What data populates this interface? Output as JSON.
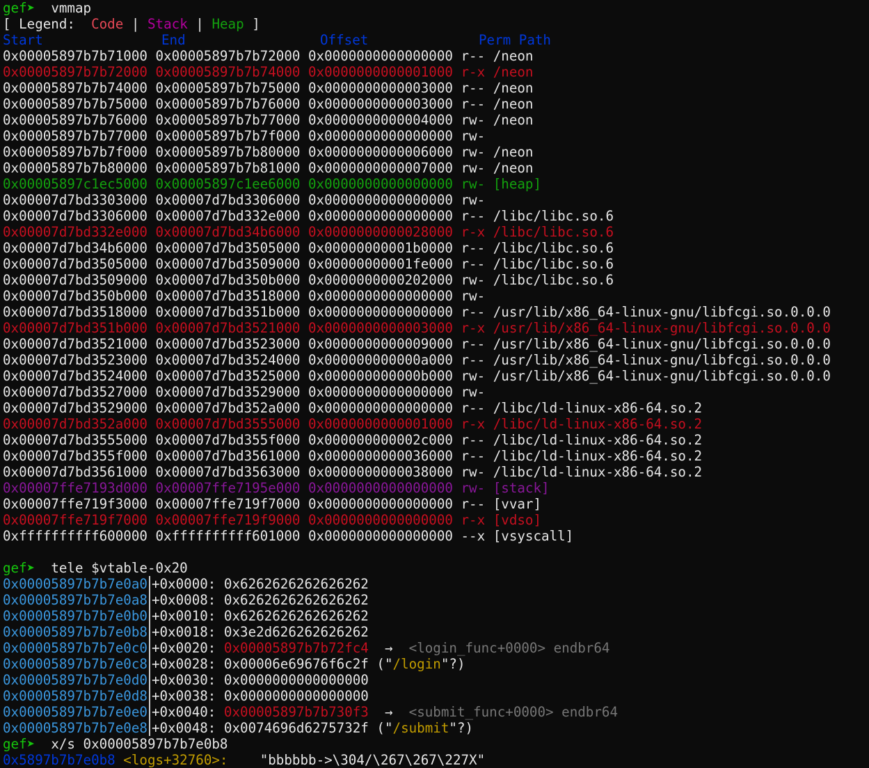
{
  "colors": {
    "background": "#0c0c0c",
    "text": "#e6e6e6",
    "prompt": "#16c60c",
    "code": "#c50f1f",
    "stack": "#881798",
    "heap": "#13a10e",
    "header": "#0037da",
    "address": "#3a96dd",
    "string": "#c19c00"
  },
  "prompt": "gef➤",
  "cmd_vmmap": "vmmap",
  "legend": {
    "prefix": "[ Legend:",
    "code": "Code",
    "sep": "|",
    "stack": "Stack",
    "heap": "Heap",
    "suffix": "]"
  },
  "vmmap_header": {
    "start": "Start",
    "end": "End",
    "offset": "Offset",
    "perm": "Perm",
    "path": "Path"
  },
  "vmmap_rows": [
    {
      "start": "0x00005897b7b71000",
      "end": "0x00005897b7b72000",
      "offset": "0x0000000000000000",
      "perm": "r--",
      "path": "/neon",
      "kind": "normal"
    },
    {
      "start": "0x00005897b7b72000",
      "end": "0x00005897b7b74000",
      "offset": "0x0000000000001000",
      "perm": "r-x",
      "path": "/neon",
      "kind": "code"
    },
    {
      "start": "0x00005897b7b74000",
      "end": "0x00005897b7b75000",
      "offset": "0x0000000000003000",
      "perm": "r--",
      "path": "/neon",
      "kind": "normal"
    },
    {
      "start": "0x00005897b7b75000",
      "end": "0x00005897b7b76000",
      "offset": "0x0000000000003000",
      "perm": "r--",
      "path": "/neon",
      "kind": "normal"
    },
    {
      "start": "0x00005897b7b76000",
      "end": "0x00005897b7b77000",
      "offset": "0x0000000000004000",
      "perm": "rw-",
      "path": "/neon",
      "kind": "normal"
    },
    {
      "start": "0x00005897b7b77000",
      "end": "0x00005897b7b7f000",
      "offset": "0x0000000000000000",
      "perm": "rw-",
      "path": "",
      "kind": "normal"
    },
    {
      "start": "0x00005897b7b7f000",
      "end": "0x00005897b7b80000",
      "offset": "0x0000000000006000",
      "perm": "rw-",
      "path": "/neon",
      "kind": "normal"
    },
    {
      "start": "0x00005897b7b80000",
      "end": "0x00005897b7b81000",
      "offset": "0x0000000000007000",
      "perm": "rw-",
      "path": "/neon",
      "kind": "normal"
    },
    {
      "start": "0x00005897c1ec5000",
      "end": "0x00005897c1ee6000",
      "offset": "0x0000000000000000",
      "perm": "rw-",
      "path": "[heap]",
      "kind": "heap"
    },
    {
      "start": "0x00007d7bd3303000",
      "end": "0x00007d7bd3306000",
      "offset": "0x0000000000000000",
      "perm": "rw-",
      "path": "",
      "kind": "normal"
    },
    {
      "start": "0x00007d7bd3306000",
      "end": "0x00007d7bd332e000",
      "offset": "0x0000000000000000",
      "perm": "r--",
      "path": "/libc/libc.so.6",
      "kind": "normal"
    },
    {
      "start": "0x00007d7bd332e000",
      "end": "0x00007d7bd34b6000",
      "offset": "0x0000000000028000",
      "perm": "r-x",
      "path": "/libc/libc.so.6",
      "kind": "code"
    },
    {
      "start": "0x00007d7bd34b6000",
      "end": "0x00007d7bd3505000",
      "offset": "0x00000000001b0000",
      "perm": "r--",
      "path": "/libc/libc.so.6",
      "kind": "normal"
    },
    {
      "start": "0x00007d7bd3505000",
      "end": "0x00007d7bd3509000",
      "offset": "0x00000000001fe000",
      "perm": "r--",
      "path": "/libc/libc.so.6",
      "kind": "normal"
    },
    {
      "start": "0x00007d7bd3509000",
      "end": "0x00007d7bd350b000",
      "offset": "0x0000000000202000",
      "perm": "rw-",
      "path": "/libc/libc.so.6",
      "kind": "normal"
    },
    {
      "start": "0x00007d7bd350b000",
      "end": "0x00007d7bd3518000",
      "offset": "0x0000000000000000",
      "perm": "rw-",
      "path": "",
      "kind": "normal"
    },
    {
      "start": "0x00007d7bd3518000",
      "end": "0x00007d7bd351b000",
      "offset": "0x0000000000000000",
      "perm": "r--",
      "path": "/usr/lib/x86_64-linux-gnu/libfcgi.so.0.0.0",
      "kind": "normal"
    },
    {
      "start": "0x00007d7bd351b000",
      "end": "0x00007d7bd3521000",
      "offset": "0x0000000000003000",
      "perm": "r-x",
      "path": "/usr/lib/x86_64-linux-gnu/libfcgi.so.0.0.0",
      "kind": "code"
    },
    {
      "start": "0x00007d7bd3521000",
      "end": "0x00007d7bd3523000",
      "offset": "0x0000000000009000",
      "perm": "r--",
      "path": "/usr/lib/x86_64-linux-gnu/libfcgi.so.0.0.0",
      "kind": "normal"
    },
    {
      "start": "0x00007d7bd3523000",
      "end": "0x00007d7bd3524000",
      "offset": "0x000000000000a000",
      "perm": "r--",
      "path": "/usr/lib/x86_64-linux-gnu/libfcgi.so.0.0.0",
      "kind": "normal"
    },
    {
      "start": "0x00007d7bd3524000",
      "end": "0x00007d7bd3525000",
      "offset": "0x000000000000b000",
      "perm": "rw-",
      "path": "/usr/lib/x86_64-linux-gnu/libfcgi.so.0.0.0",
      "kind": "normal"
    },
    {
      "start": "0x00007d7bd3527000",
      "end": "0x00007d7bd3529000",
      "offset": "0x0000000000000000",
      "perm": "rw-",
      "path": "",
      "kind": "normal"
    },
    {
      "start": "0x00007d7bd3529000",
      "end": "0x00007d7bd352a000",
      "offset": "0x0000000000000000",
      "perm": "r--",
      "path": "/libc/ld-linux-x86-64.so.2",
      "kind": "normal"
    },
    {
      "start": "0x00007d7bd352a000",
      "end": "0x00007d7bd3555000",
      "offset": "0x0000000000001000",
      "perm": "r-x",
      "path": "/libc/ld-linux-x86-64.so.2",
      "kind": "code"
    },
    {
      "start": "0x00007d7bd3555000",
      "end": "0x00007d7bd355f000",
      "offset": "0x000000000002c000",
      "perm": "r--",
      "path": "/libc/ld-linux-x86-64.so.2",
      "kind": "normal"
    },
    {
      "start": "0x00007d7bd355f000",
      "end": "0x00007d7bd3561000",
      "offset": "0x0000000000036000",
      "perm": "r--",
      "path": "/libc/ld-linux-x86-64.so.2",
      "kind": "normal"
    },
    {
      "start": "0x00007d7bd3561000",
      "end": "0x00007d7bd3563000",
      "offset": "0x0000000000038000",
      "perm": "rw-",
      "path": "/libc/ld-linux-x86-64.so.2",
      "kind": "normal"
    },
    {
      "start": "0x00007ffe7193d000",
      "end": "0x00007ffe7195e000",
      "offset": "0x0000000000000000",
      "perm": "rw-",
      "path": "[stack]",
      "kind": "stack"
    },
    {
      "start": "0x00007ffe719f3000",
      "end": "0x00007ffe719f7000",
      "offset": "0x0000000000000000",
      "perm": "r--",
      "path": "[vvar]",
      "kind": "normal"
    },
    {
      "start": "0x00007ffe719f7000",
      "end": "0x00007ffe719f9000",
      "offset": "0x0000000000000000",
      "perm": "r-x",
      "path": "[vdso]",
      "kind": "code"
    },
    {
      "start": "0xffffffffff600000",
      "end": "0xffffffffff601000",
      "offset": "0x0000000000000000",
      "perm": "--x",
      "path": "[vsyscall]",
      "kind": "normal"
    }
  ],
  "cmd_tele": "tele $vtable-0x20",
  "tele_rows": [
    {
      "addr": "0x00005897b7b7e0a0",
      "off": "+0x0000:",
      "value": "0x6262626262626262",
      "value_kind": "plain",
      "arrow": "",
      "sym": "",
      "insn": "",
      "str": ""
    },
    {
      "addr": "0x00005897b7b7e0a8",
      "off": "+0x0008:",
      "value": "0x6262626262626262",
      "value_kind": "plain",
      "arrow": "",
      "sym": "",
      "insn": "",
      "str": ""
    },
    {
      "addr": "0x00005897b7b7e0b0",
      "off": "+0x0010:",
      "value": "0x6262626262626262",
      "value_kind": "plain",
      "arrow": "",
      "sym": "",
      "insn": "",
      "str": ""
    },
    {
      "addr": "0x00005897b7b7e0b8",
      "off": "+0x0018:",
      "value": "0x3e2d626262626262",
      "value_kind": "plain",
      "arrow": "",
      "sym": "",
      "insn": "",
      "str": ""
    },
    {
      "addr": "0x00005897b7b7e0c0",
      "off": "+0x0020:",
      "value": "0x00005897b7b72fc4",
      "value_kind": "code",
      "arrow": "→",
      "sym": "<login_func+0000>",
      "insn": "endbr64",
      "str": ""
    },
    {
      "addr": "0x00005897b7b7e0c8",
      "off": "+0x0028:",
      "value": "0x00006e69676f6c2f",
      "value_kind": "plain",
      "arrow": "",
      "sym": "",
      "insn": "",
      "str": "/login"
    },
    {
      "addr": "0x00005897b7b7e0d0",
      "off": "+0x0030:",
      "value": "0x0000000000000000",
      "value_kind": "plain",
      "arrow": "",
      "sym": "",
      "insn": "",
      "str": ""
    },
    {
      "addr": "0x00005897b7b7e0d8",
      "off": "+0x0038:",
      "value": "0x0000000000000000",
      "value_kind": "plain",
      "arrow": "",
      "sym": "",
      "insn": "",
      "str": ""
    },
    {
      "addr": "0x00005897b7b7e0e0",
      "off": "+0x0040:",
      "value": "0x00005897b7b730f3",
      "value_kind": "code",
      "arrow": "→",
      "sym": "<submit_func+0000>",
      "insn": "endbr64",
      "str": ""
    },
    {
      "addr": "0x00005897b7b7e0e8",
      "off": "+0x0048:",
      "value": "0x0074696d6275732f",
      "value_kind": "plain",
      "arrow": "",
      "sym": "",
      "insn": "",
      "str": "/submit"
    }
  ],
  "str_prefix": "(\"",
  "str_suffix": "\"?)",
  "cmd_xs": "x/s 0x00005897b7b7e0b8",
  "xs_result": {
    "addr": "0x5897b7b7e0b8",
    "sym": "<logs+32760>:",
    "value": "\"bbbbbb->\\304/\\267\\267\\227X\""
  }
}
